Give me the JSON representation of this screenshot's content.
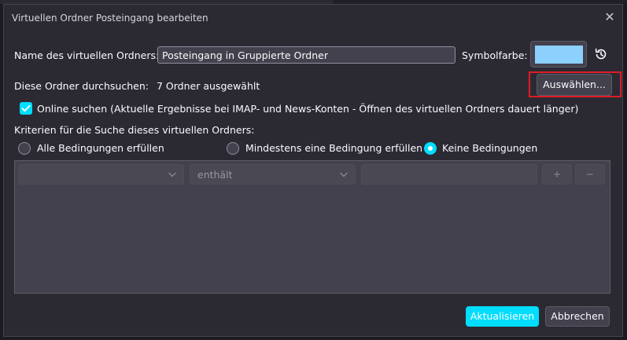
{
  "dialog": {
    "title": "Virtuellen Ordner Posteingang bearbeiten",
    "close_glyph": "✕"
  },
  "folder_name": {
    "label": "Name des virtuellen Ordners:",
    "value": "Posteingang in Gruppierte Ordner"
  },
  "icon_color": {
    "label": "Symbolfarbe:",
    "swatch_color": "#8cd0fd"
  },
  "search_folders": {
    "label": "Diese Ordner durchsuchen:",
    "value": "7 Ordner ausgewählt",
    "choose_button": "Auswählen..."
  },
  "online_search": {
    "checked": true,
    "label": "Online suchen (Aktuelle Ergebnisse bei IMAP- und News-Konten - Öffnen des virtuellen Ordners dauert länger)"
  },
  "criteria": {
    "heading": "Kriterien für die Suche dieses virtuellen Ordners:",
    "options": [
      {
        "label": "Alle Bedingungen erfüllen",
        "selected": false
      },
      {
        "label": "Mindestens eine Bedingung erfüllen",
        "selected": false
      },
      {
        "label": "Keine Bedingungen",
        "selected": true
      }
    ]
  },
  "term_row": {
    "attribute_value": "",
    "operator_value": "enthält",
    "match_value": "",
    "add_label": "+",
    "remove_label": "−"
  },
  "footer": {
    "update_button": "Aktualisieren",
    "cancel_button": "Abbrechen"
  },
  "colors": {
    "accent": "#0df",
    "highlight": "#e01b24"
  },
  "icons": [
    "close-icon",
    "reset-icon",
    "checkmark-icon",
    "chevron-down-icon"
  ]
}
